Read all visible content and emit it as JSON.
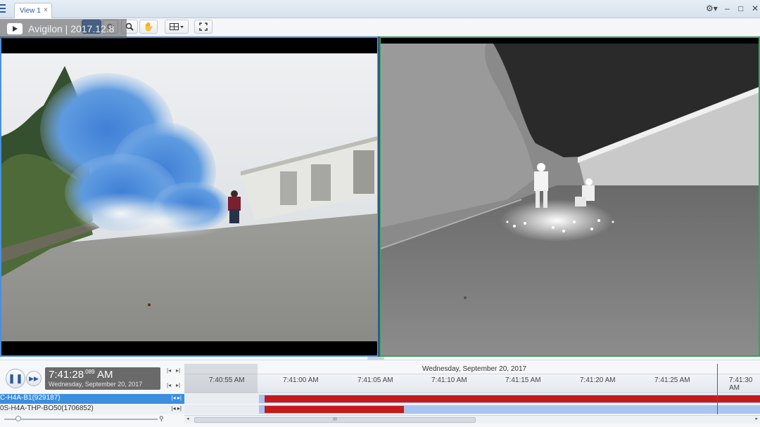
{
  "window": {
    "tab_label": "View 1",
    "tab_close": "×",
    "controls": [
      "⚙▾",
      "–",
      "□",
      "✕"
    ]
  },
  "toolbar": {
    "buttons": [
      "zoom-icon",
      "hand-icon",
      "layout-icon",
      "fullscreen-icon"
    ]
  },
  "watermark": {
    "text": "Avigilon | 2017.12.8"
  },
  "playback": {
    "time": "7:41:28",
    "time_ms": ".089",
    "ampm": "AM",
    "date": "Wednesday, September 20, 2017"
  },
  "timeline": {
    "date_header": "Wednesday, September 20, 2017",
    "ticks": [
      "7:40:55 AM",
      "7:41:00 AM",
      "7:41:05 AM",
      "7:41:10 AM",
      "7:41:15 AM",
      "7:41:20 AM",
      "7:41:25 AM",
      "7:41:30 AM"
    ],
    "scroll_grip": "III"
  },
  "cameras": [
    {
      "label": "C-H4A-B1(929187)",
      "selected": true
    },
    {
      "label": "0S-H4A-THP-BO50(1706852)",
      "selected": false
    }
  ],
  "colors": {
    "accent": "#3b8ee0",
    "recording": "#c41a1a",
    "left_border": "#4a90d9",
    "right_border": "#3aa35a"
  }
}
